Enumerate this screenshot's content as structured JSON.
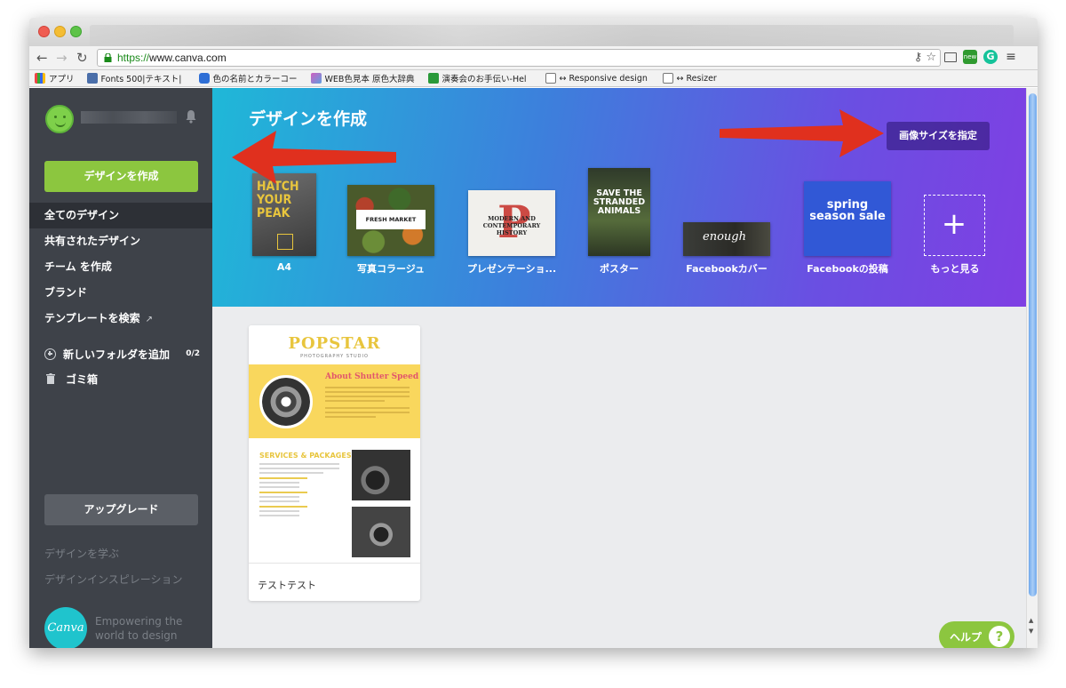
{
  "browser": {
    "url_scheme": "https://",
    "url_host": "www.canva.com",
    "bookmarks": [
      {
        "label": "アプリ",
        "color": "#3a7be0"
      },
      {
        "label": "Fonts 500|テキスト|",
        "color": "#4a6ea9"
      },
      {
        "label": "色の名前とカラーコー",
        "color": "#2f6fd6"
      },
      {
        "label": "WEB色見本 原色大辞典",
        "color": "#d05fc0"
      },
      {
        "label": "演奏会のお手伝い-Hel",
        "color": "#2a9a3a"
      },
      {
        "label": "↔ Responsive design",
        "color": "#ffffff"
      },
      {
        "label": "↔ Resizer",
        "color": "#ffffff"
      }
    ]
  },
  "sidebar": {
    "create_button": "デザインを作成",
    "nav": [
      {
        "label": "全てのデザイン",
        "active": true
      },
      {
        "label": "共有されたデザイン",
        "active": false
      },
      {
        "label": "チーム を作成",
        "active": false
      },
      {
        "label": "ブランド",
        "active": false
      },
      {
        "label": "テンプレートを検索",
        "active": false
      }
    ],
    "external_arrow": "↗",
    "new_folder_label": "新しいフォルダを追加",
    "folder_count": "0/2",
    "trash_label": "ゴミ箱",
    "upgrade_button": "アップグレード",
    "learn_link": "デザインを学ぶ",
    "inspiration_link": "デザインインスピレーション",
    "logo_text": "Canva",
    "tagline": "Empowering the world to design"
  },
  "hero": {
    "title": "デザインを作成",
    "custom_size_button": "画像サイズを指定",
    "templates": [
      {
        "label": "A4",
        "thumb_text": "HATCH YOUR PEAK"
      },
      {
        "label": "写真コラージュ",
        "thumb_text": "FRESH MARKET"
      },
      {
        "label": "プレゼンテーショ...",
        "thumb_text": "MODERN AND CONTEMPORARY HISTORY"
      },
      {
        "label": "ポスター",
        "thumb_text": "SAVE THE STRANDED ANIMALS"
      },
      {
        "label": "Facebookカバー",
        "thumb_text": "enough"
      },
      {
        "label": "Facebookの投稿",
        "thumb_text": "spring season sale"
      },
      {
        "label": "もっと見る",
        "thumb_text": "+"
      }
    ]
  },
  "designs": [
    {
      "name": "テストテスト",
      "preview": {
        "title": "POPSTAR",
        "subtitle": "PHOTOGRAPHY STUDIO",
        "heading": "About Shutter Speed",
        "section": "SERVICES & PACKAGES"
      }
    }
  ],
  "help_button": "ヘルプ",
  "colors": {
    "sidebar_bg": "#3e4249",
    "accent_green": "#8cc63f",
    "hero_start": "#1fb8d8",
    "hero_end": "#7f3fe3",
    "arrow_red": "#e0301e"
  }
}
